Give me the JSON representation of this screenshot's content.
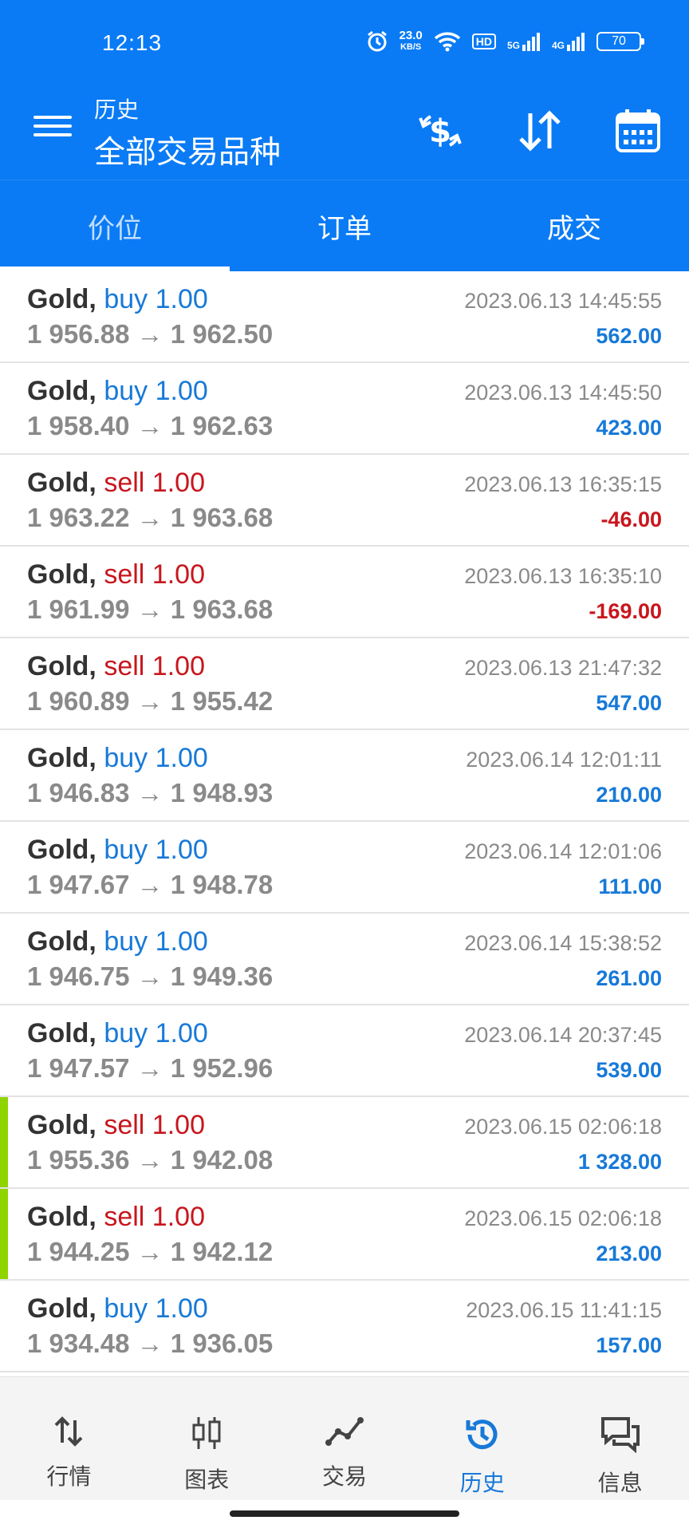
{
  "status": {
    "time": "12:13",
    "net_speed_value": "23.0",
    "net_speed_unit": "KB/S",
    "hd": "HD",
    "sig1": "5G",
    "sig2": "4G",
    "battery": "70",
    "icons": [
      "alarm-icon",
      "wifi-icon",
      "hd-icon",
      "signal-5g-icon",
      "signal-4g-icon",
      "battery-icon"
    ]
  },
  "header": {
    "subtitle": "历史",
    "title": "全部交易品种",
    "icons": [
      "menu-icon",
      "dollar-swap-icon",
      "sort-icon",
      "calendar-icon"
    ]
  },
  "tabs": [
    {
      "label": "价位",
      "active": true
    },
    {
      "label": "订单",
      "active": false
    },
    {
      "label": "成交",
      "active": false
    }
  ],
  "trades": [
    {
      "symbol": "Gold,",
      "side": "buy",
      "volume": "buy 1.00",
      "prices": "1 956.88 → 1 962.50",
      "date": "2023.06.13 14:45:55",
      "profit": "562.00",
      "marked": false
    },
    {
      "symbol": "Gold,",
      "side": "buy",
      "volume": "buy 1.00",
      "prices": "1 958.40 → 1 962.63",
      "date": "2023.06.13 14:45:50",
      "profit": "423.00",
      "marked": false
    },
    {
      "symbol": "Gold,",
      "side": "sell",
      "volume": "sell 1.00",
      "prices": "1 963.22 → 1 963.68",
      "date": "2023.06.13 16:35:15",
      "profit": "-46.00",
      "marked": false
    },
    {
      "symbol": "Gold,",
      "side": "sell",
      "volume": "sell 1.00",
      "prices": "1 961.99 → 1 963.68",
      "date": "2023.06.13 16:35:10",
      "profit": "-169.00",
      "marked": false
    },
    {
      "symbol": "Gold,",
      "side": "sell",
      "volume": "sell 1.00",
      "prices": "1 960.89 → 1 955.42",
      "date": "2023.06.13 21:47:32",
      "profit": "547.00",
      "marked": false
    },
    {
      "symbol": "Gold,",
      "side": "buy",
      "volume": "buy 1.00",
      "prices": "1 946.83 → 1 948.93",
      "date": "2023.06.14 12:01:11",
      "profit": "210.00",
      "marked": false
    },
    {
      "symbol": "Gold,",
      "side": "buy",
      "volume": "buy 1.00",
      "prices": "1 947.67 → 1 948.78",
      "date": "2023.06.14 12:01:06",
      "profit": "111.00",
      "marked": false
    },
    {
      "symbol": "Gold,",
      "side": "buy",
      "volume": "buy 1.00",
      "prices": "1 946.75 → 1 949.36",
      "date": "2023.06.14 15:38:52",
      "profit": "261.00",
      "marked": false
    },
    {
      "symbol": "Gold,",
      "side": "buy",
      "volume": "buy 1.00",
      "prices": "1 947.57 → 1 952.96",
      "date": "2023.06.14 20:37:45",
      "profit": "539.00",
      "marked": false
    },
    {
      "symbol": "Gold,",
      "side": "sell",
      "volume": "sell 1.00",
      "prices": "1 955.36 → 1 942.08",
      "date": "2023.06.15 02:06:18",
      "profit": "1 328.00",
      "marked": true
    },
    {
      "symbol": "Gold,",
      "side": "sell",
      "volume": "sell 1.00",
      "prices": "1 944.25 → 1 942.12",
      "date": "2023.06.15 02:06:18",
      "profit": "213.00",
      "marked": true
    },
    {
      "symbol": "Gold,",
      "side": "buy",
      "volume": "buy 1.00",
      "prices": "1 934.48 → 1 936.05",
      "date": "2023.06.15 11:41:15",
      "profit": "157.00",
      "marked": false
    }
  ],
  "nav": [
    {
      "label": "行情",
      "icon": "quotes-icon",
      "active": false
    },
    {
      "label": "图表",
      "icon": "chart-icon",
      "active": false
    },
    {
      "label": "交易",
      "icon": "trade-icon",
      "active": false
    },
    {
      "label": "历史",
      "icon": "history-icon",
      "active": true
    },
    {
      "label": "信息",
      "icon": "messages-icon",
      "active": false
    }
  ],
  "colors": {
    "primary": "#0a7bf5",
    "buy": "#1779d8",
    "sell": "#c8161d",
    "marker": "#8fd400"
  }
}
